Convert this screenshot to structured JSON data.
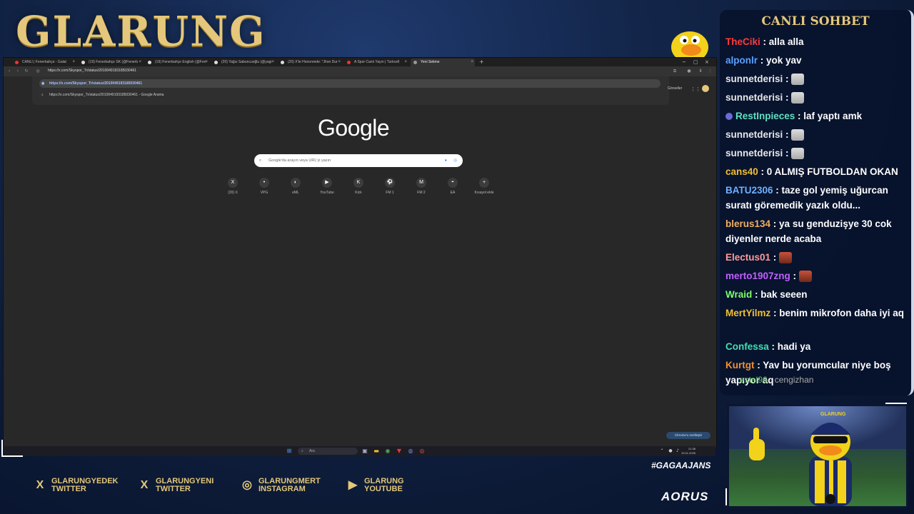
{
  "overlay": {
    "logo": "GLARUNG",
    "hashtag": "#GAGAAJANS",
    "brand": "AORUS"
  },
  "browser": {
    "tabs": [
      {
        "label": "CANLI | Fenerbahçe - Galat",
        "fav": "#e33"
      },
      {
        "label": "(19) Fenerbahçe SK (@Fenerb",
        "fav": "#ddd"
      },
      {
        "label": "(19) Fenerbahçe English (@Fen",
        "fav": "#ddd"
      },
      {
        "label": "(20) Yağız Sabuncuoğlu (@yagi",
        "fav": "#ddd"
      },
      {
        "label": "(20) X'te Hononrede: \"Jhon Dur",
        "fav": "#ddd"
      },
      {
        "label": "A Spor Canlı Yayın | Turkcell",
        "fav": "#e33"
      },
      {
        "label": "Yeni Sekme",
        "fav": "#999"
      }
    ],
    "address": "https://x.com/Skyspor_Tr/status/2010049193185030461",
    "suggestions": [
      "https://x.com/Skyspor_Tr/status/2010049193185030461",
      "https://x.com/Skyspor_Tr/status/2010049193185030461 - Google Arama"
    ],
    "right_label": "Görseller",
    "google_logo": "Google",
    "search_placeholder": "Google'da arayın veya URL'yi yazın",
    "shortcuts": [
      {
        "label": "(20) X",
        "icon": "X"
      },
      {
        "label": "VPG",
        "icon": "•"
      },
      {
        "label": "eML",
        "icon": "◐"
      },
      {
        "label": "YouTube",
        "icon": "▶"
      },
      {
        "label": "Kick",
        "icon": "K"
      },
      {
        "label": "FM 1",
        "icon": "⚽"
      },
      {
        "label": "FM 2",
        "icon": "M"
      },
      {
        "label": "EA",
        "icon": "◓"
      },
      {
        "label": "Kısayol ekle",
        "icon": "+"
      }
    ],
    "customize_label": "Chrome'u özelleştir"
  },
  "taskbar": {
    "search_label": "Ara",
    "time": "21:38",
    "date": "10.01.2026"
  },
  "chat": {
    "title": "CANLI SOHBET",
    "messages": [
      {
        "user": "TheCiki",
        "color": "#ff3b3b",
        "text": "alla alla"
      },
      {
        "user": "alponlr",
        "color": "#5aa0ff",
        "text": "yok yav"
      },
      {
        "user": "sunnetderisi",
        "color": "#e6e6e6",
        "text": "",
        "emote": "cat"
      },
      {
        "user": "sunnetderisi",
        "color": "#e6e6e6",
        "text": "",
        "emote": "cat"
      },
      {
        "user": "RestInpieces",
        "color": "#5fe0c0",
        "text": "laf yaptı amk",
        "badge": true
      },
      {
        "user": "sunnetderisi",
        "color": "#e6e6e6",
        "text": "",
        "emote": "cat"
      },
      {
        "user": "sunnetderisi",
        "color": "#e6e6e6",
        "text": "",
        "emote": "cat"
      },
      {
        "user": "cans40",
        "color": "#f0c030",
        "text": "0 ALMIŞ FUTBOLDAN OKAN"
      },
      {
        "user": "BATU2306",
        "color": "#6fb0ff",
        "text": "taze gol yemiş uğurcan suratı göremedik yazık oldu..."
      },
      {
        "user": "blerus134",
        "color": "#f0b060",
        "text": "ya su genduzişye 30 cok diyenler nerde acaba"
      },
      {
        "user": "Electus01",
        "color": "#ff9a9a",
        "text": "",
        "emote": "face"
      },
      {
        "user": "merto1907zng",
        "color": "#c060ff",
        "text": "",
        "emote": "face"
      },
      {
        "user": "Wraid",
        "color": "#7cff6a",
        "text": "bak seeen"
      },
      {
        "user": "MertYilmz",
        "color": "#f0c030",
        "text": "benim mikrofon daha iyi aq"
      },
      {
        "user": "Confessa",
        "color": "#40e0b0",
        "text": "hadi ya"
      },
      {
        "user": "Kurtgt",
        "color": "#f09030",
        "text": "Yav bu yorumcular niye boş yapıyor aq"
      }
    ],
    "typing_user": "estel96",
    "typing_text": "cengizhan"
  },
  "socials": [
    {
      "icon": "X",
      "line1": "GLARUNGYEDEK",
      "line2": "TWITTER"
    },
    {
      "icon": "X",
      "line1": "GLARUNGYENI",
      "line2": "TWITTER"
    },
    {
      "icon": "◎",
      "line1": "GLARUNGMERT",
      "line2": "INSTAGRAM"
    },
    {
      "icon": "▶",
      "line1": "GLARUNG",
      "line2": "YOUTUBE"
    }
  ],
  "cam": {
    "cap_text": "GLARUNG"
  }
}
